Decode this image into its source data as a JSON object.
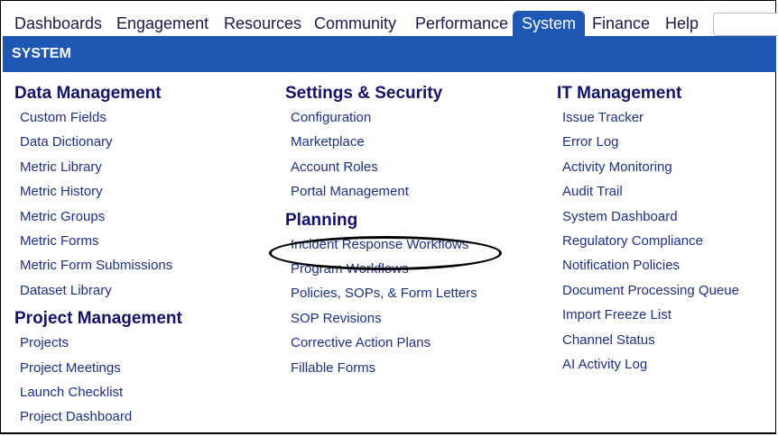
{
  "nav": {
    "tabs": [
      "Dashboards",
      "Engagement",
      "Resources",
      "Community",
      "Performance",
      "System",
      "Finance",
      "Help"
    ],
    "active": "System"
  },
  "banner": {
    "title": "SYSTEM"
  },
  "columns": [
    {
      "sections": [
        {
          "heading": "Data Management",
          "items": [
            "Custom Fields",
            "Data Dictionary",
            "Metric Library",
            "Metric History",
            "Metric Groups",
            "Metric Forms",
            "Metric Form Submissions",
            "Dataset Library"
          ]
        },
        {
          "heading": "Project Management",
          "items": [
            "Projects",
            "Project Meetings",
            "Launch Checklist",
            "Project Dashboard"
          ]
        }
      ]
    },
    {
      "sections": [
        {
          "heading": "Settings & Security",
          "items": [
            "Configuration",
            "Marketplace",
            "Account Roles",
            "Portal Management"
          ]
        },
        {
          "heading": "Planning",
          "items": [
            "Incident Response Workflows",
            "Program Workflows",
            "Policies, SOPs, & Form Letters",
            "SOP Revisions",
            "Corrective Action Plans",
            "Fillable Forms"
          ]
        }
      ]
    },
    {
      "sections": [
        {
          "heading": "IT Management",
          "items": [
            "Issue Tracker",
            "Error Log",
            "Activity Monitoring",
            "Audit Trail",
            "System Dashboard",
            "Regulatory Compliance",
            "Notification Policies",
            "Document Processing Queue",
            "Import Freeze List",
            "Channel Status",
            "AI Activity Log"
          ]
        }
      ]
    }
  ],
  "highlight": "Incident Response Workflows"
}
